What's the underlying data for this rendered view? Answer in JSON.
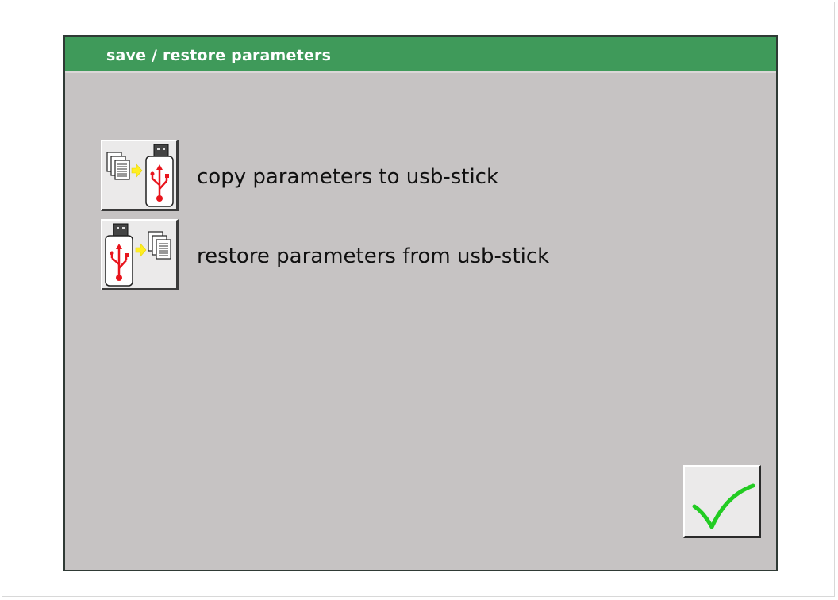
{
  "dialog": {
    "title": "save / restore parameters"
  },
  "actions": [
    {
      "label": "copy parameters to usb-stick",
      "icon": "copy-to-usb-icon"
    },
    {
      "label": "restore parameters from usb-stick",
      "icon": "restore-from-usb-icon"
    }
  ],
  "confirm": {
    "icon": "checkmark-icon"
  },
  "colors": {
    "title_bar": "#3f9a5a",
    "panel": "#c6c3c3",
    "usb_symbol": "#e8141c",
    "arrow": "#ffee22",
    "checkmark": "#22cc22"
  }
}
